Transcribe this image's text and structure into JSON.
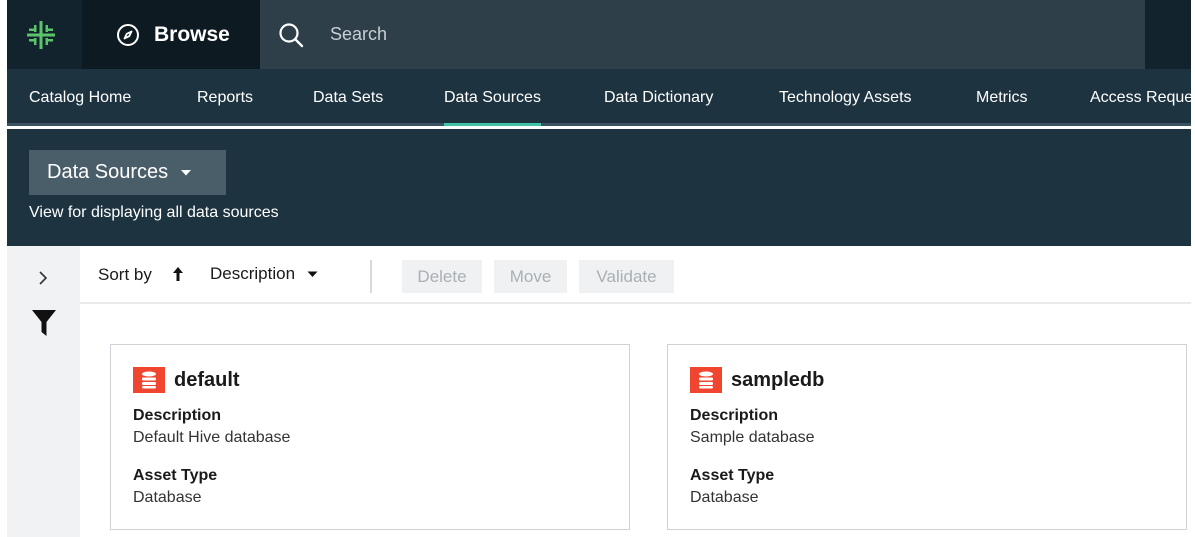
{
  "topbar": {
    "browse_label": "Browse",
    "search_placeholder": "Search"
  },
  "nav": {
    "tabs": [
      {
        "label": "Catalog Home",
        "active": false
      },
      {
        "label": "Reports",
        "active": false
      },
      {
        "label": "Data Sets",
        "active": false
      },
      {
        "label": "Data Sources",
        "active": true
      },
      {
        "label": "Data Dictionary",
        "active": false
      },
      {
        "label": "Technology Assets",
        "active": false
      },
      {
        "label": "Metrics",
        "active": false
      },
      {
        "label": "Access Reque",
        "active": false
      }
    ]
  },
  "header": {
    "view_label": "Data Sources",
    "view_description": "View for displaying all data sources"
  },
  "toolbar": {
    "sort_by_label": "Sort by",
    "sort_field": "Description",
    "sort_direction": "ascending",
    "delete_label": "Delete",
    "move_label": "Move",
    "validate_label": "Validate"
  },
  "cards": [
    {
      "name": "default",
      "description_label": "Description",
      "description": "Default Hive database",
      "asset_type_label": "Asset Type",
      "asset_type": "Database"
    },
    {
      "name": "sampledb",
      "description_label": "Description",
      "description": "Sample database",
      "asset_type_label": "Asset Type",
      "asset_type": "Database"
    }
  ],
  "colors": {
    "topbar_bg": "#13232d",
    "nav_bg": "#1d3340",
    "active_tab_underline": "#40c4a4",
    "logo_green": "#59c46a",
    "db_icon_red": "#f0452f"
  },
  "icons": {
    "logo": "tree-logo-icon",
    "browse": "compass-icon",
    "search": "search-icon",
    "view_dropdown": "caret-down-icon",
    "rail_expand": "chevron-right-icon",
    "rail_filter": "filter-icon",
    "sort": "arrow-up-icon",
    "card": "database-icon"
  }
}
